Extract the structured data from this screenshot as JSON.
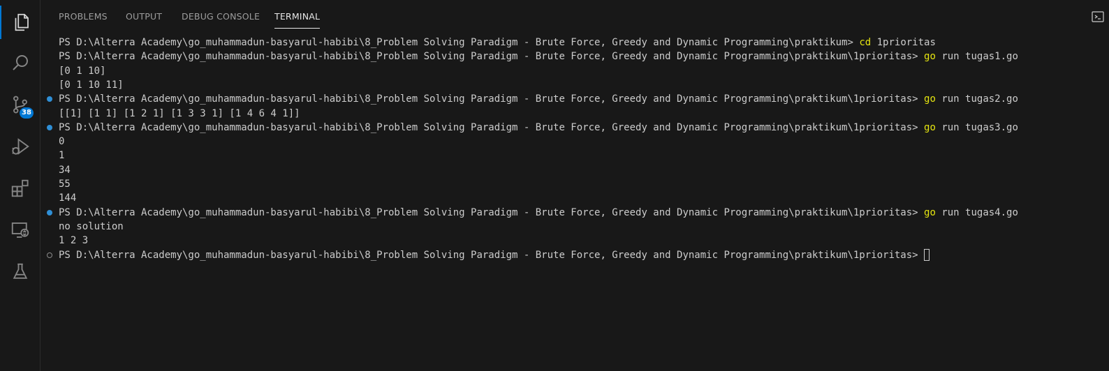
{
  "panel": {
    "tabs": [
      {
        "label": "PROBLEMS"
      },
      {
        "label": "OUTPUT"
      },
      {
        "label": "DEBUG CONSOLE"
      },
      {
        "label": "TERMINAL"
      }
    ],
    "active_tab": "TERMINAL"
  },
  "activity_bar": {
    "items": [
      {
        "icon": "explorer-icon"
      },
      {
        "icon": "search-icon"
      },
      {
        "icon": "source-control-icon",
        "badge": "38"
      },
      {
        "icon": "run-debug-icon"
      },
      {
        "icon": "extensions-icon"
      },
      {
        "icon": "remote-explorer-icon"
      },
      {
        "icon": "testing-icon"
      }
    ]
  },
  "terminal": {
    "lines": [
      {
        "text": "PS D:\\Alterra Academy\\go_muhammadun-basyarul-habibi\\8_Problem Solving Paradigm - Brute Force, Greedy and Dynamic Programming\\praktikum> ",
        "cmd": "cd",
        "arg": " 1prioritas",
        "decor": ""
      },
      {
        "text": "PS D:\\Alterra Academy\\go_muhammadun-basyarul-habibi\\8_Problem Solving Paradigm - Brute Force, Greedy and Dynamic Programming\\praktikum\\1prioritas> ",
        "cmd": "go",
        "arg": " run tugas1.go",
        "decor": ""
      },
      {
        "text": "[0 1 10]",
        "decor": ""
      },
      {
        "text": "[0 1 10 11]",
        "decor": ""
      },
      {
        "text": "PS D:\\Alterra Academy\\go_muhammadun-basyarul-habibi\\8_Problem Solving Paradigm - Brute Force, Greedy and Dynamic Programming\\praktikum\\1prioritas> ",
        "cmd": "go",
        "arg": " run tugas2.go",
        "decor": "ok"
      },
      {
        "text": "[[1] [1 1] [1 2 1] [1 3 3 1] [1 4 6 4 1]]",
        "decor": ""
      },
      {
        "text": "PS D:\\Alterra Academy\\go_muhammadun-basyarul-habibi\\8_Problem Solving Paradigm - Brute Force, Greedy and Dynamic Programming\\praktikum\\1prioritas> ",
        "cmd": "go",
        "arg": " run tugas3.go",
        "decor": "ok"
      },
      {
        "text": "0",
        "decor": ""
      },
      {
        "text": "1",
        "decor": ""
      },
      {
        "text": "34",
        "decor": ""
      },
      {
        "text": "55",
        "decor": ""
      },
      {
        "text": "144",
        "decor": ""
      },
      {
        "text": "PS D:\\Alterra Academy\\go_muhammadun-basyarul-habibi\\8_Problem Solving Paradigm - Brute Force, Greedy and Dynamic Programming\\praktikum\\1prioritas> ",
        "cmd": "go",
        "arg": " run tugas4.go",
        "decor": "ok"
      },
      {
        "text": "no solution",
        "decor": ""
      },
      {
        "text": "1 2 3",
        "decor": ""
      },
      {
        "text": "PS D:\\Alterra Academy\\go_muhammadun-basyarul-habibi\\8_Problem Solving Paradigm - Brute Force, Greedy and Dynamic Programming\\praktikum\\1prioritas> ",
        "decor": "empty",
        "cursor": true
      }
    ]
  },
  "colors": {
    "background": "#181818",
    "accent": "#0078d4",
    "command": "#e5e510",
    "text": "#cccccc"
  }
}
